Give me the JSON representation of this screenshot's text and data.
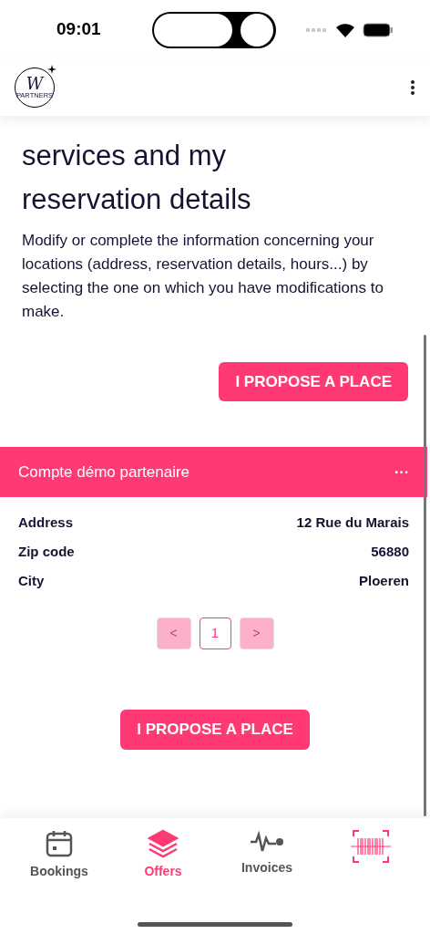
{
  "status_bar": {
    "time": "09:01"
  },
  "header": {
    "logo": {
      "letter": "W",
      "caption": "PARTNERS"
    }
  },
  "intro": {
    "title_lines": [
      "services and my",
      "reservation details"
    ],
    "text": "Modify or complete the information concerning your locations (address, reservation details, hours...) by selecting the one on which you have modifications to make."
  },
  "top_button": "I PROPOSE A PLACE",
  "location_card": {
    "title": "Compte démo partenaire",
    "menu": "···",
    "fields": [
      {
        "label": "Address",
        "value": "12 Rue du Marais"
      },
      {
        "label": "Zip code",
        "value": "56880"
      },
      {
        "label": "City",
        "value": "Ploeren"
      }
    ]
  },
  "pagination": {
    "prev": {
      "label": "<",
      "disabled": true
    },
    "pages": [
      {
        "label": "1",
        "selected": true
      }
    ],
    "next": {
      "label": ">",
      "disabled": true
    }
  },
  "bottom_button": "I PROPOSE A PLACE",
  "tab_bar": [
    {
      "kind": "calendar",
      "label": "Bookings",
      "selected": false
    },
    {
      "kind": "layers",
      "label": "Offers",
      "selected": true
    },
    {
      "kind": "pulse",
      "label": "Invoices",
      "selected": false
    },
    {
      "kind": "scanner"
    }
  ]
}
